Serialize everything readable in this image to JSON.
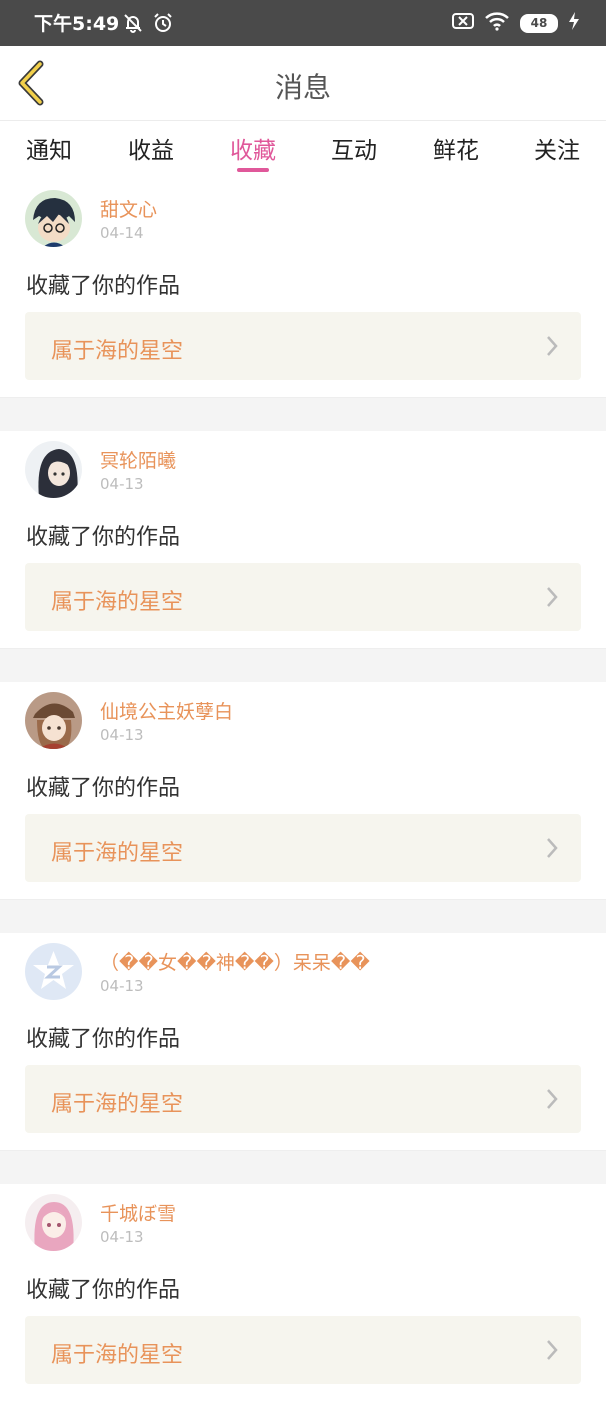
{
  "status_bar": {
    "time": "下午5:49",
    "battery": "48",
    "icons": [
      "mute-bell-icon",
      "alarm-icon",
      "sim-off-icon",
      "wifi-icon",
      "battery-icon",
      "charging-bolt-icon"
    ]
  },
  "header": {
    "title": "消息",
    "back_icon": "chevron-left-icon"
  },
  "tabs": [
    {
      "label": "通知",
      "active": false
    },
    {
      "label": "收益",
      "active": false
    },
    {
      "label": "收藏",
      "active": true
    },
    {
      "label": "互动",
      "active": false
    },
    {
      "label": "鲜花",
      "active": false
    },
    {
      "label": "关注",
      "active": false
    }
  ],
  "colors": {
    "accent_pink": "#e0589a",
    "username_orange": "#e8935a",
    "link_bg": "#f6f5ee"
  },
  "messages": [
    {
      "user": "甜文心",
      "date": "04-14",
      "action": "收藏了你的作品",
      "work": "属于海的星空",
      "avatar": "anime-boy-avatar"
    },
    {
      "user": "冥轮陌曦",
      "date": "04-13",
      "action": "收藏了你的作品",
      "work": "属于海的星空",
      "avatar": "dark-hair-girl-avatar"
    },
    {
      "user": "仙境公主妖孽白",
      "date": "04-13",
      "action": "收藏了你的作品",
      "work": "属于海的星空",
      "avatar": "hat-girl-avatar"
    },
    {
      "user": "（��女��神��）呆呆��",
      "date": "04-13",
      "action": "收藏了你的作品",
      "work": "属于海的星空",
      "avatar": "default-qzone-avatar"
    },
    {
      "user": "千城ぼ雪",
      "date": "04-13",
      "action": "收藏了你的作品",
      "work": "属于海的星空",
      "avatar": "pink-hair-girl-avatar"
    }
  ]
}
